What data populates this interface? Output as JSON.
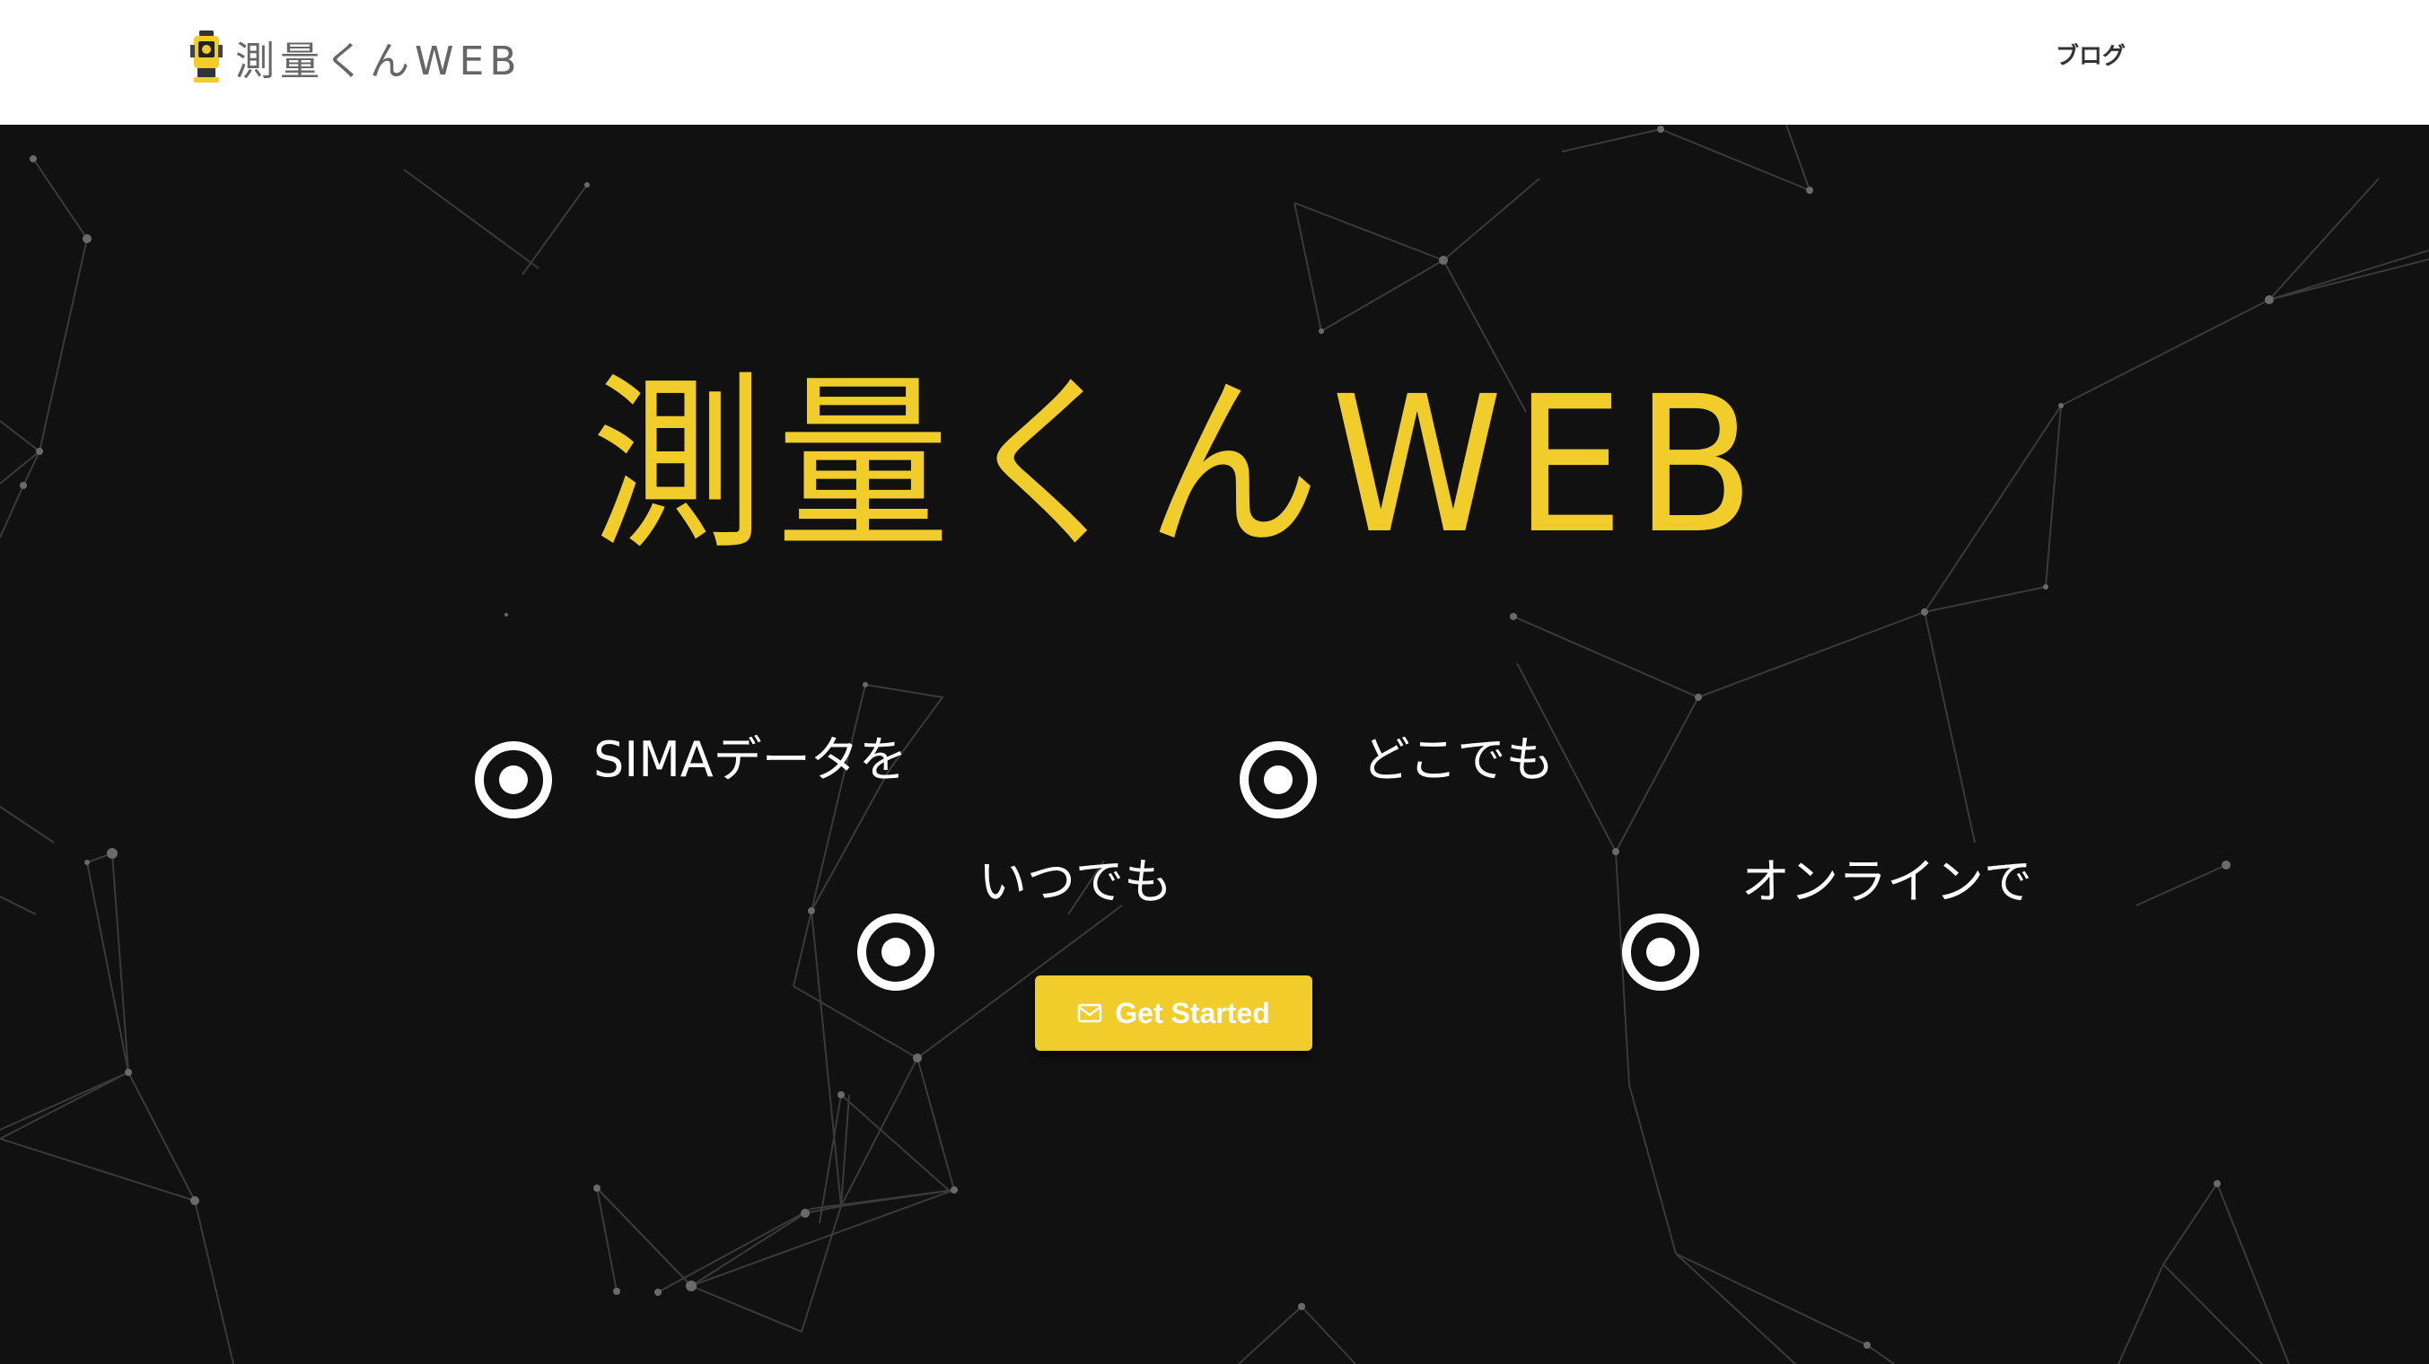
{
  "header": {
    "brand_text": "測量くんWEB",
    "nav": {
      "blog_label": "ブログ"
    }
  },
  "hero": {
    "title": "測量くんWEB",
    "features": [
      {
        "label": "SIMAデータを"
      },
      {
        "label": "どこでも"
      },
      {
        "label": "いつでも"
      },
      {
        "label": "オンラインで"
      }
    ],
    "cta": {
      "label": "Get Started",
      "icon": "mail-icon"
    }
  },
  "colors": {
    "accent": "#f1cd2c",
    "background": "#111111",
    "header_bg": "#ffffff",
    "text_light": "#ffffff"
  }
}
